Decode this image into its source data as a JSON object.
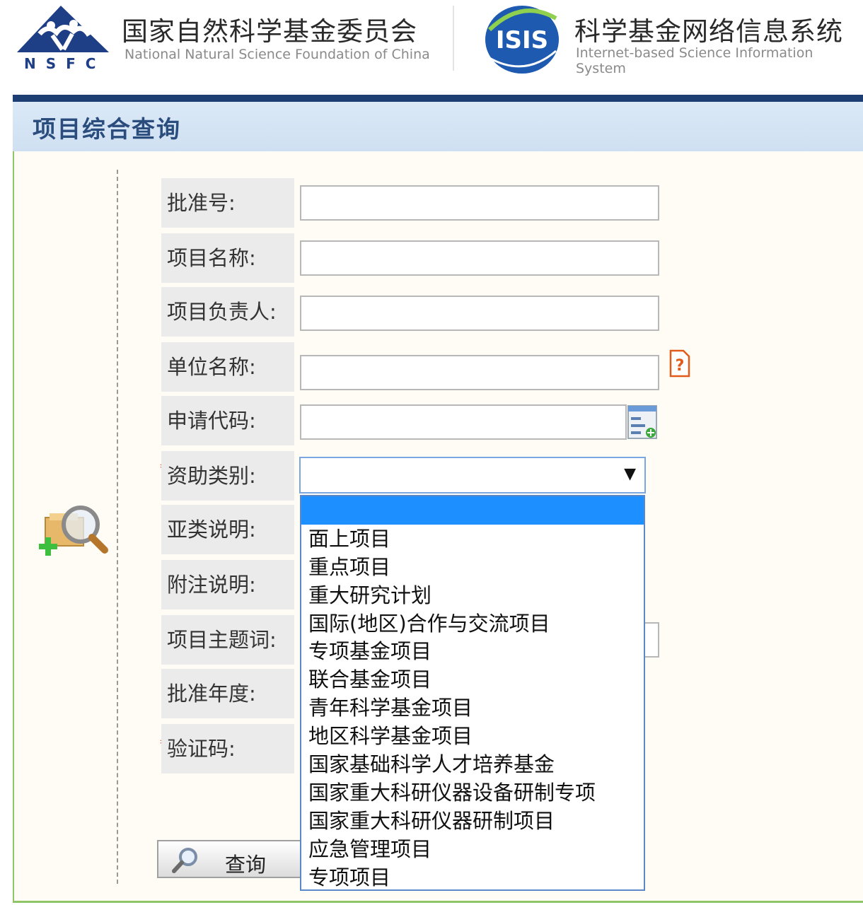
{
  "header": {
    "org_name_cn": "国家自然科学基金委员会",
    "org_name_en": "National Natural Science Foundation of China",
    "org_abbr": "NSFC",
    "system_logo_text": "ISIS",
    "system_name_cn": "科学基金网络信息系统",
    "system_name_en": "Internet-based Science Information System"
  },
  "page_title": "项目综合查询",
  "form": {
    "fields": [
      {
        "label": "批准号:",
        "value": "",
        "required": false
      },
      {
        "label": "项目名称:",
        "value": "",
        "required": false
      },
      {
        "label": "项目负责人:",
        "value": "",
        "required": false
      },
      {
        "label": "单位名称:",
        "value": "",
        "required": false
      },
      {
        "label": "申请代码:",
        "value": "",
        "required": false
      },
      {
        "label": "资助类别:",
        "value": "",
        "required": true
      },
      {
        "label": "亚类说明:",
        "value": "",
        "required": false
      },
      {
        "label": "附注说明:",
        "value": "",
        "required": false
      },
      {
        "label": "项目主题词:",
        "value": "",
        "required": false
      },
      {
        "label": "批准年度:",
        "value": "",
        "required": false
      },
      {
        "label": "验证码:",
        "value": "",
        "required": true
      }
    ],
    "required_marker": "*",
    "funding_category": {
      "selected": "",
      "arrow": "▼",
      "options": [
        "",
        "面上项目",
        "重点项目",
        "重大研究计划",
        "国际(地区)合作与交流项目",
        "专项基金项目",
        "联合基金项目",
        "青年科学基金项目",
        "地区科学基金项目",
        "国家基础科学人才培养基金",
        "国家重大科研仪器设备研制专项",
        "国家重大科研仪器研制项目",
        "应急管理项目",
        "专项项目"
      ]
    },
    "query_button": "查询"
  },
  "icons": {
    "help": "help-icon",
    "code_picker": "code-picker-icon",
    "search_panel": "search-add-icon",
    "query": "magnifier-icon"
  },
  "colors": {
    "title_bar_line": "#1d3e72",
    "title_text": "#2a4d7d",
    "panel_border": "#8fc467",
    "dropdown_highlight": "#1e8fff"
  }
}
